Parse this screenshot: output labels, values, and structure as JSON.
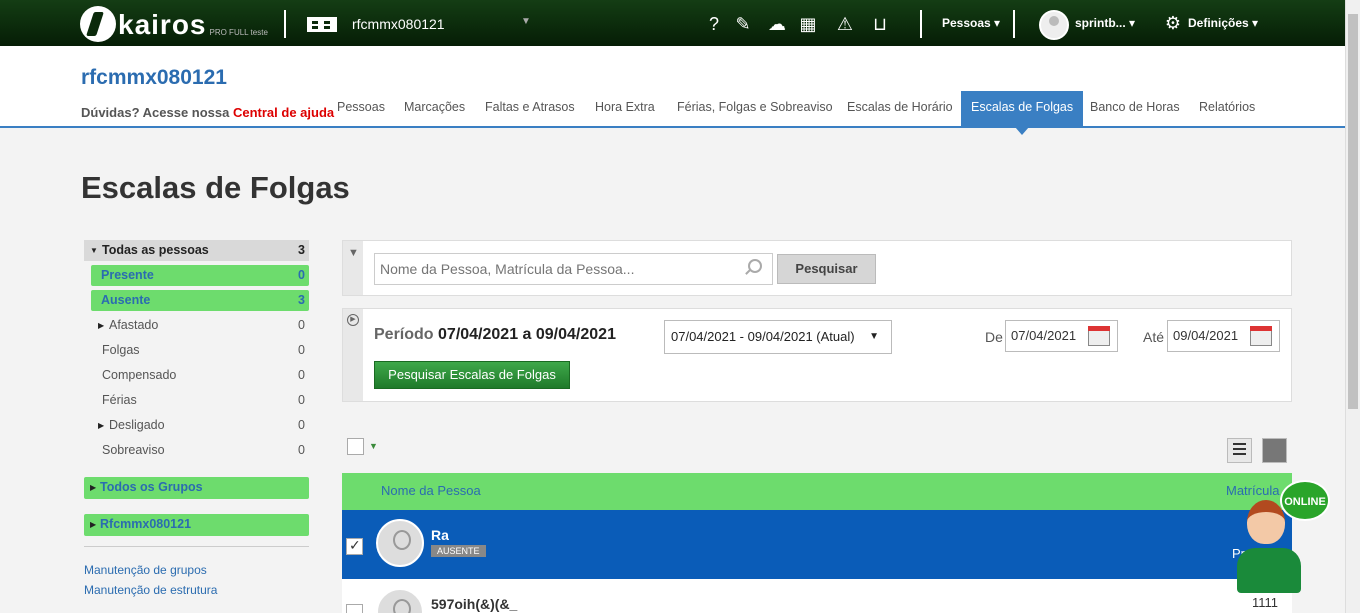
{
  "topbar": {
    "logo_text": "kairos",
    "logo_sub": "PRO FULL teste",
    "company": "rfcmmx080121",
    "icons": [
      "help-icon",
      "feedback-icon",
      "cloud-icon",
      "calculator-icon",
      "warning-icon",
      "inbox-icon"
    ],
    "pessoas_label": "Pessoas",
    "user_label": "sprintb...",
    "settings_label": "Definições"
  },
  "header": {
    "company_title": "rfcmmx080121",
    "help_text": "Dúvidas? Acesse nossa ",
    "help_link": "Central de ajuda",
    "tabs": [
      "Pessoas",
      "Marcações",
      "Faltas e Atrasos",
      "Hora Extra",
      "Férias, Folgas e Sobreaviso",
      "Escalas de Horário",
      "Escalas de Folgas",
      "Banco de Horas",
      "Relatórios"
    ],
    "active_tab": "Escalas de Folgas"
  },
  "page_title": "Escalas de Folgas",
  "sidebar": {
    "all": {
      "label": "Todas as pessoas",
      "count": "3"
    },
    "items": [
      {
        "label": "Presente",
        "count": "0"
      },
      {
        "label": "Ausente",
        "count": "3"
      },
      {
        "label": "Afastado",
        "count": "0"
      },
      {
        "label": "Folgas",
        "count": "0"
      },
      {
        "label": "Compensado",
        "count": "0"
      },
      {
        "label": "Férias",
        "count": "0"
      },
      {
        "label": "Desligado",
        "count": "0"
      },
      {
        "label": "Sobreaviso",
        "count": "0"
      }
    ],
    "groups": [
      "Todos os Grupos",
      "Rfcmmx080121"
    ],
    "links": [
      "Manutenção de grupos",
      "Manutenção de estrutura"
    ]
  },
  "search": {
    "placeholder": "Nome da Pessoa, Matrícula da Pessoa...",
    "button": "Pesquisar"
  },
  "period": {
    "label": "Período",
    "range": "07/04/2021 a 09/04/2021",
    "select_value": "07/04/2021 - 09/04/2021 (Atual)",
    "de_label": "De",
    "de_value": "07/04/2021",
    "ate_label": "Até",
    "ate_value": "09/04/2021",
    "button": "Pesquisar Escalas de Folgas"
  },
  "list": {
    "col_name": "Nome da Pessoa",
    "col_matricula": "Matrícula",
    "rows": [
      {
        "name": "Ra",
        "badge": "AUSENTE",
        "matricula": "Pr"
      },
      {
        "name": "597oih(&)(&_",
        "matricula": "1111"
      }
    ]
  },
  "online_widget": "ONLINE"
}
